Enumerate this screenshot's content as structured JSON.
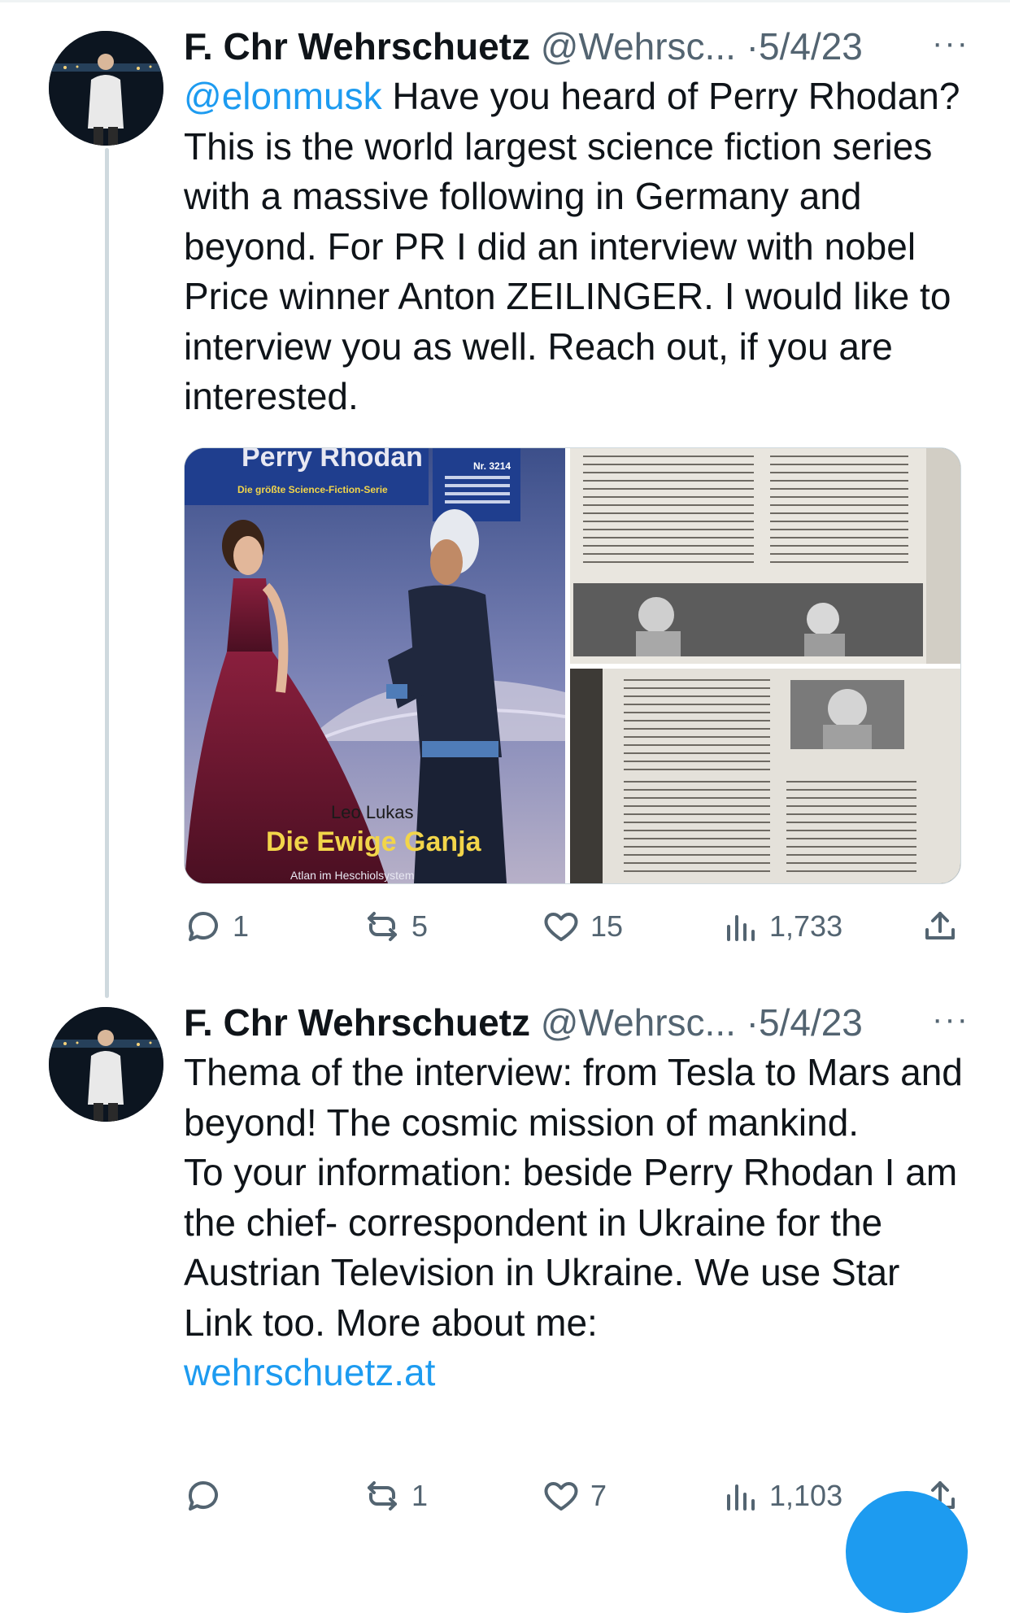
{
  "tweets": [
    {
      "name": "F. Chr Wehrschuetz",
      "handle": "@Wehrsc...",
      "separator": "·",
      "date": "5/4/23",
      "more": "···",
      "mention": "@elonmusk",
      "text": " Have you heard of Perry Rhodan? This is the world largest science fiction series with a massive following in Germany and beyond. For PR I did an interview with nobel Price winner Anton ZEILINGER. I would like to interview you as well. Reach out, if you are interested.",
      "media": {
        "cover": {
          "brand": "Perry Rhodan",
          "tagline": "Die größte Science-Fiction-Serie",
          "issue": "Nr. 3214",
          "author": "Leo Lukas",
          "title": "Die Ewige Ganja",
          "subtitle": "Atlan im Heschiolsystem"
        }
      },
      "stats": {
        "replies": "1",
        "reposts": "5",
        "likes": "15",
        "views": "1,733"
      }
    },
    {
      "name": "F. Chr Wehrschuetz",
      "handle": "@Wehrsc...",
      "separator": "·",
      "date": "5/4/23",
      "more": "···",
      "lines": [
        "Thema of the interview: from Tesla to Mars and beyond! The cosmic mission of mankind.",
        "To your information: beside Perry Rhodan I am the chief- correspondent in Ukraine for the Austrian Television in Ukraine. We use Star Link too. More about me:"
      ],
      "link": "wehrschuetz.at",
      "stats": {
        "replies": "",
        "reposts": "1",
        "likes": "7",
        "views": "1,103"
      }
    }
  ],
  "icons": [
    "reply-icon",
    "repost-icon",
    "like-icon",
    "views-icon",
    "share-icon",
    "more-icon"
  ],
  "colors": {
    "accent": "#1d9bf0",
    "secondary_text": "#536471",
    "thread_line": "#cfd9de"
  }
}
